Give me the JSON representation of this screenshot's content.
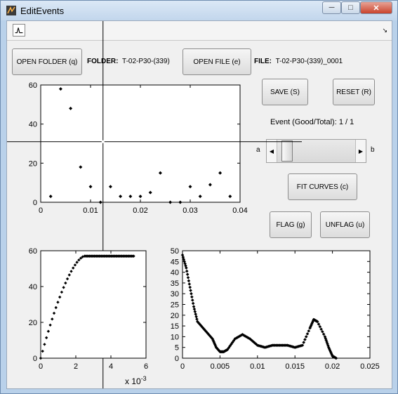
{
  "window": {
    "title": "EditEvents",
    "caption_buttons": [
      "minimize",
      "maximize",
      "close"
    ]
  },
  "toolbar": {
    "icon": "waveform-icon",
    "overflow_arrow": "chevron-icon"
  },
  "controls": {
    "open_folder_label": "OPEN FOLDER (q)",
    "folder_label": "FOLDER:",
    "folder_value": "T-02-P30-(339)",
    "open_file_label": "OPEN FILE (e)",
    "file_label": "FILE:",
    "file_value": "T-02-P30-(339)_0001",
    "save_label": "SAVE (S)",
    "reset_label": "RESET (R)",
    "event_status": "Event (Good/Total): 1 / 1",
    "slider_left_label": "a",
    "slider_right_label": "b",
    "slider_value_fraction": 0.07,
    "fit_curves_label": "FIT CURVES (c)",
    "flag_label": "FLAG (g)",
    "unflag_label": "UNFLAG (u)"
  },
  "chart_data": [
    {
      "type": "scatter",
      "title": "",
      "xlim": [
        0,
        0.04
      ],
      "ylim": [
        0,
        60
      ],
      "x_ticks": [
        "0",
        "0.01",
        "0.02",
        "0.03",
        "0.04"
      ],
      "y_ticks": [
        "0",
        "20",
        "40",
        "60"
      ],
      "points": [
        [
          0.002,
          3
        ],
        [
          0.004,
          58
        ],
        [
          0.006,
          48
        ],
        [
          0.008,
          18
        ],
        [
          0.01,
          8
        ],
        [
          0.012,
          0
        ],
        [
          0.014,
          8
        ],
        [
          0.016,
          3
        ],
        [
          0.018,
          3
        ],
        [
          0.02,
          3
        ],
        [
          0.022,
          5
        ],
        [
          0.024,
          15
        ],
        [
          0.026,
          0
        ],
        [
          0.028,
          0
        ],
        [
          0.03,
          8
        ],
        [
          0.032,
          3
        ],
        [
          0.034,
          9
        ],
        [
          0.036,
          15
        ],
        [
          0.038,
          3
        ]
      ],
      "crosshair": {
        "x": 0.0125,
        "y": 31
      }
    },
    {
      "type": "scatter",
      "xlim": [
        0,
        0.006
      ],
      "ylim": [
        0,
        60
      ],
      "x_ticks": [
        "0",
        "2",
        "4",
        "6"
      ],
      "y_ticks": [
        "0",
        "20",
        "40",
        "60"
      ],
      "x_exponent": "x 10",
      "x_exponent_power": "-3",
      "rise_end_x": 0.0025,
      "plateau_end_x": 0.0053,
      "plateau_y": 57,
      "rise_points": 24,
      "plateau_points": 50,
      "crosshair_x": 0.0035
    },
    {
      "type": "line",
      "xlim": [
        0,
        0.025
      ],
      "ylim": [
        0,
        50
      ],
      "x_ticks": [
        "0",
        "0.005",
        "0.01",
        "0.015",
        "0.02",
        "0.025"
      ],
      "y_ticks": [
        "0",
        "5",
        "10",
        "15",
        "20",
        "25",
        "30",
        "35",
        "40",
        "45",
        "50"
      ],
      "series": [
        {
          "points": [
            [
              0,
              48
            ],
            [
              0.0005,
              42
            ],
            [
              0.001,
              33
            ],
            [
              0.0015,
              24
            ],
            [
              0.002,
              17
            ],
            [
              0.003,
              13
            ],
            [
              0.004,
              9
            ],
            [
              0.0045,
              5
            ],
            [
              0.005,
              3
            ],
            [
              0.0055,
              3
            ],
            [
              0.006,
              4
            ],
            [
              0.007,
              9
            ],
            [
              0.008,
              11
            ],
            [
              0.009,
              9
            ],
            [
              0.01,
              6
            ],
            [
              0.011,
              5
            ],
            [
              0.012,
              6
            ],
            [
              0.013,
              6
            ],
            [
              0.014,
              6
            ],
            [
              0.015,
              5
            ],
            [
              0.016,
              6
            ],
            [
              0.017,
              14
            ],
            [
              0.0175,
              18
            ],
            [
              0.018,
              17
            ],
            [
              0.019,
              10
            ],
            [
              0.0195,
              5
            ],
            [
              0.02,
              1
            ],
            [
              0.0205,
              0
            ]
          ]
        }
      ]
    }
  ]
}
